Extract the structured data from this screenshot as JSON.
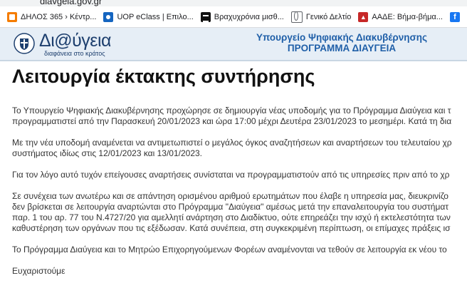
{
  "browser": {
    "url": "diavgeia.gov.gr",
    "bookmarks": [
      {
        "icon": "orange-square-icon",
        "label": "ΔΗΛΟΣ 365 › Κέντρ..."
      },
      {
        "icon": "uop-icon",
        "label": "UOP eClass | Επιλο..."
      },
      {
        "icon": "dark-square-icon",
        "label": "Βραχυχρόνια μισθ..."
      },
      {
        "icon": "globe-icon",
        "label": "Γενικό Δελτίο"
      },
      {
        "icon": "aade-icon",
        "label": "ΑΑΔΕ: Βήμα-βήμα..."
      },
      {
        "icon": "facebook-icon",
        "label": ""
      },
      {
        "icon": "skype-icon",
        "label": ""
      }
    ]
  },
  "site": {
    "logo_text": "Δι@ύγεια",
    "tagline": "διαφάνεια στο κράτος",
    "ministry_line1": "Υπουργείο Ψηφιακής Διακυβέρνησης",
    "ministry_line2": "ΠΡΟΓΡΑΜΜΑ ΔΙΑΥΓΕΙΑ"
  },
  "content": {
    "title": "Λειτουργία έκτακτης συντήρησης",
    "paragraphs": [
      [
        "Το Υπουργείο Ψηφιακής Διακυβέρνησης προχώρησε σε δημιουργία νέας υποδομής για το Πρόγραμμα Διαύγεια και τ",
        "προγραμματιστεί από την Παρασκευή 20/01/2023 και ώρα 17:00 μέχρι Δευτέρα 23/01/2023 το μεσημέρι. Κατά τη δια"
      ],
      [
        "Με την νέα υποδομή αναμένεται να αντιμετωπιστεί ο μεγάλος όγκος αναζητήσεων και αναρτήσεων του τελευταίου χρ",
        "συστήματος ιδίως στις 12/01/2023 και 13/01/2023."
      ],
      [
        "Για τον λόγο αυτό τυχόν επείγουσες αναρτήσεις συνίσταται να προγραμματιστούν από τις υπηρεσίες πριν από το χρ"
      ],
      [
        "Σε συνέχεια των ανωτέρω και σε απάντηση ορισμένου αριθμού ερωτημάτων που έλαβε η υπηρεσία μας, διευκρινίζο",
        "δεν βρίσκεται σε λειτουργία αναρτώνται στο Πρόγραμμα \"Διαύγεια\" αμέσως μετά την επαναλειτουργία του συστήματ",
        "παρ. 1 του αρ. 77 του Ν.4727/20 για αμελλητί ανάρτηση στο Διαδίκτυο, ούτε επηρεάζει την ισχύ ή εκτελεστότητα των",
        "καθυστέρηση των οργάνων που τις εξέδωσαν. Κατά συνέπεια, στη συγκεκριμένη περίπτωση, οι επίμαχες πράξεις ισ"
      ],
      [
        "Το Πρόγραμμα Διαύγεια και το Μητρώο Επιχορηγούμενων Φορέων αναμένονται να τεθούν σε λειτουργία εκ νέου το"
      ],
      [
        "Ευχαριστούμε"
      ]
    ]
  }
}
